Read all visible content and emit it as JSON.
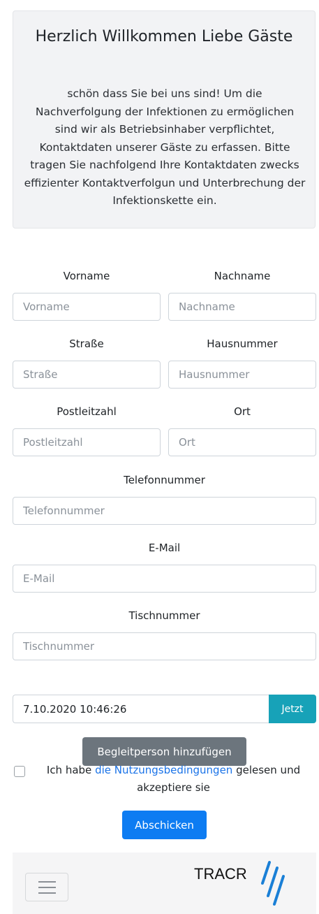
{
  "welcome": {
    "title": "Herzlich Willkommen Liebe Gäste",
    "text": "schön dass Sie bei uns sind! Um die Nachverfolgung der Infektionen zu ermöglichen sind wir als Betriebsinhaber verpflichtet, Kontaktdaten unserer Gäste zu erfassen. Bitte tragen Sie nachfolgend Ihre Kontaktdaten zwecks effizienter Kontaktverfolgun und Unterbrechung der Infektionskette ein."
  },
  "form": {
    "vorname": {
      "label": "Vorname",
      "placeholder": "Vorname"
    },
    "nachname": {
      "label": "Nachname",
      "placeholder": "Nachname"
    },
    "strasse": {
      "label": "Straße",
      "placeholder": "Straße"
    },
    "hausnummer": {
      "label": "Hausnummer",
      "placeholder": "Hausnummer"
    },
    "plz": {
      "label": "Postleitzahl",
      "placeholder": "Postleitzahl"
    },
    "ort": {
      "label": "Ort",
      "placeholder": "Ort"
    },
    "telefon": {
      "label": "Telefonnummer",
      "placeholder": "Telefonnummer"
    },
    "email": {
      "label": "E-Mail",
      "placeholder": "E-Mail"
    },
    "tisch": {
      "label": "Tischnummer",
      "placeholder": "Tischnummer"
    },
    "datetime": {
      "value": "7.10.2020 10:46:26",
      "button": "Jetzt"
    },
    "companion_button": "Begleitperson hinzufügen",
    "terms": {
      "before": "Ich habe ",
      "link": "die Nutzungsbedingungen",
      "after": " gelesen und akzeptiere sie"
    },
    "submit": "Abschicken"
  },
  "navbar": {
    "logo_text": "TRACR",
    "logo_color": "#1a7fd6",
    "toggler_icon": "hamburger-menu-icon"
  }
}
